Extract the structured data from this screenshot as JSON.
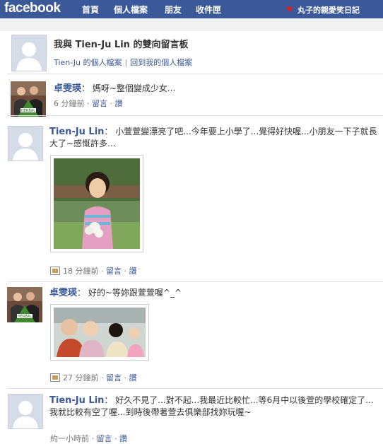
{
  "topbar": {
    "logo": "facebook",
    "nav": [
      "首頁",
      "個人檔案",
      "朋友",
      "收件匣"
    ],
    "right_label": "丸子的親愛笑日記"
  },
  "header": {
    "title": "我與 Tien-Ju Lin 的雙向留言板",
    "link_profile": "Tien-Ju 的個人檔案",
    "link_separator": "|",
    "link_back": "回到我的個人檔案"
  },
  "posts": [
    {
      "author": "卓雯瑛",
      "colon": "：",
      "text": "媽呀~整個變成少女...",
      "time": "6 分鐘前",
      "comment": "留言",
      "like": "讚",
      "dot": "·"
    },
    {
      "author": "Tien-Ju Lin",
      "colon": "：",
      "text": "小萱萱變漂亮了吧...今年要上小學了...覺得好快喔...小朋友一下子就長大了~感慨許多...",
      "time": "18 分鐘前",
      "comment": "留言",
      "like": "讚",
      "dot": "·"
    },
    {
      "author": "卓雯瑛",
      "colon": "：",
      "text": "好的~等妳跟萱萱喔^_^",
      "time": "27 分鐘前",
      "comment": "留言",
      "like": "讚",
      "dot": "·"
    },
    {
      "author": "Tien-Ju Lin",
      "colon": "：",
      "text": "好久不見了...對不起...我最近比較忙...等6月中以後萱的學校確定了...我就比較有空了喔...到時後帶著萱去俱樂部找妳玩喔~",
      "time": "約一小時前",
      "comment": "留言",
      "like": "讚",
      "dot": "·"
    }
  ],
  "avatar_badge_text": "HERBAL"
}
